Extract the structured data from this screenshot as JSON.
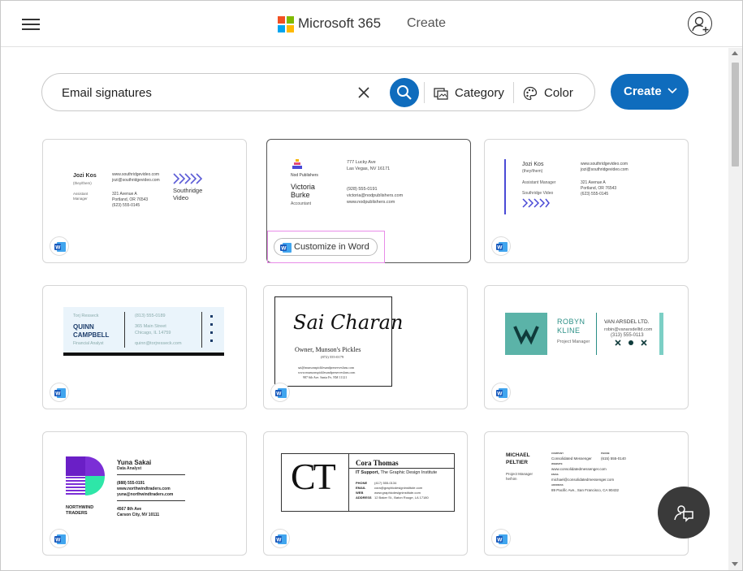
{
  "header": {
    "menu_icon": "hamburger-icon",
    "brand": "Microsoft 365",
    "create_tab": "Create",
    "profile_icon": "add-person-icon",
    "logo_colors": [
      "#f25022",
      "#7fba00",
      "#00a4ef",
      "#ffb900"
    ]
  },
  "search": {
    "value": "Email signatures",
    "clear_icon": "close-icon",
    "search_icon": "search-icon",
    "category_label": "Category",
    "color_label": "Color"
  },
  "create_button": {
    "label": "Create"
  },
  "accent": "#0f6cbd",
  "customize_label": "Customize in Word",
  "cards": [
    {
      "name": "Jozi Kos",
      "pronouns": "(they/them)",
      "title": "Assistant Manager",
      "web": "www.southridgevideo.com",
      "email": "jozi@southridgevideo.com",
      "address1": "321 Avenue A",
      "address2": "Portland, OR 76543",
      "phone": "(623) 555-0145",
      "company": "Southridge Video"
    },
    {
      "company": "Nod Publishers",
      "name": "Victoria Burke",
      "title": "Accountant",
      "address1": "777 Lucky Ave",
      "address2": "Las Vegas, NV 16171",
      "phone": "(928) 555-0191",
      "email": "victoria@nodpublishers.com",
      "web": "www.nodpublishers.com"
    },
    {
      "name": "Jozi Kos",
      "pronouns": "(they/them)",
      "title": "Assistant Manager",
      "company": "Southridge Video",
      "web": "www.southridgevideo.com",
      "email": "jozi@southridgevideo.com",
      "address1": "321 Avenue A",
      "address2": "Portland, OR 76543",
      "phone": "(623) 555-0145"
    },
    {
      "top": "Torj Resseck",
      "name1": "QUINN",
      "name2": "CAMPBELL",
      "title": "Financial Analyst",
      "phone": "(813) 555-0189",
      "address1": "365 Main Street",
      "address2": "Chicago, IL 14759",
      "email": "quinn@torjresseck.com"
    },
    {
      "name": "Sai Charan",
      "title": "Owner, Munson's Pickles",
      "phone": "(872) 555-0179",
      "email": "sai@munsonspicklesandpreservesfans.com",
      "web": "www.munsonspicklesandpreservesfans.com",
      "address": "987 6th Ave. Santa Fe, NM 11121"
    },
    {
      "name1": "ROBYN",
      "name2": "KLINE",
      "title": "Project Manager",
      "company": "VAN ARSDEL LTD.",
      "email": "robin@vanarsdelltd.com",
      "phone": "(313) 555-0113"
    },
    {
      "name": "Yuna Sakai",
      "title": "Data Analyst",
      "phone": "(888) 555-0191",
      "web": "www.northwindtraders.com",
      "email": "yuna@northwindtraders.com",
      "address1": "4567 8th Ave",
      "address2": "Carson City, NV 10111",
      "company1": "NORTHWIND",
      "company2": "TRADERS"
    },
    {
      "initials": "CT",
      "name": "Cora Thomas",
      "role": "IT Support,",
      "company": "The Graphic Design Institute",
      "labels": [
        "PHONE",
        "EMAIL",
        "WEB",
        "ADDRESS"
      ],
      "values": [
        "(417) 555-0134",
        "cora@graphicdesigninstitute.com",
        "www.graphicdesigninstitute.com",
        "12 Baker St., Baton Rouge, LA 17180"
      ]
    },
    {
      "name1": "MICHAEL",
      "name2": "PELTIER",
      "title1": "Project Manager",
      "title2": "he/him",
      "labels": [
        "COMPANY",
        "PHONE",
        "WEBSITE",
        "EMAIL",
        "ADDRESS"
      ],
      "company": "Consolidated Messenger",
      "phone": "(615) 555-0140",
      "web": "www.consolidatedmessenger.com",
      "email": "michael@consolidatedmessenger.com",
      "address": "89 Pacific Ave., San Francisco, CA 90432"
    }
  ]
}
